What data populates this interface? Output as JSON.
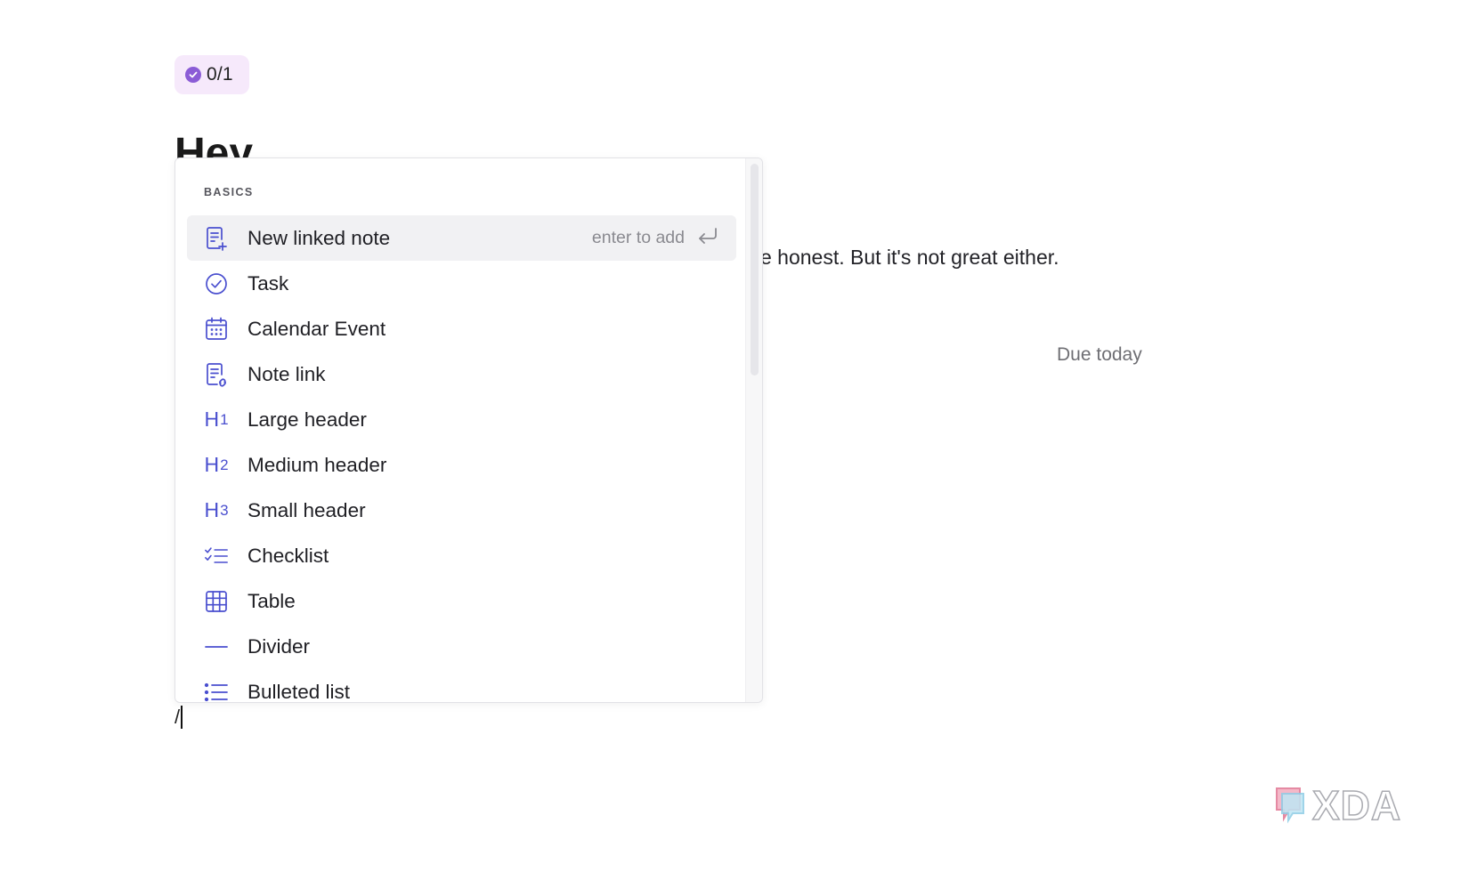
{
  "badge": {
    "count": "0/1"
  },
  "note": {
    "title": "Hey",
    "body_visible": "e honest. But it's not great either.",
    "due": "Due today",
    "slash_input": "/"
  },
  "menu": {
    "section": "BASICS",
    "items": [
      {
        "label": "New linked note",
        "icon": "new-note-icon",
        "hint": "enter to add",
        "selected": true
      },
      {
        "label": "Task",
        "icon": "task-check-icon"
      },
      {
        "label": "Calendar Event",
        "icon": "calendar-icon"
      },
      {
        "label": "Note link",
        "icon": "note-link-icon"
      },
      {
        "label": "Large header",
        "icon": "h1-icon",
        "glyph": "H",
        "sub": "1"
      },
      {
        "label": "Medium header",
        "icon": "h2-icon",
        "glyph": "H",
        "sub": "2"
      },
      {
        "label": "Small header",
        "icon": "h3-icon",
        "glyph": "H",
        "sub": "3"
      },
      {
        "label": "Checklist",
        "icon": "checklist-icon"
      },
      {
        "label": "Table",
        "icon": "table-icon"
      },
      {
        "label": "Divider",
        "icon": "divider-icon"
      },
      {
        "label": "Bulleted list",
        "icon": "bulleted-list-icon"
      }
    ]
  },
  "watermark": {
    "text": "XDA"
  },
  "colors": {
    "accent_icon": "#4a4fcf",
    "badge_bg": "#f6e9fb",
    "badge_check": "#8b5cd6",
    "selected_row": "#f1f1f3"
  }
}
